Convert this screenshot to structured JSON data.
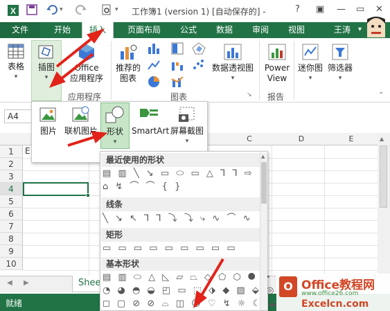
{
  "titlebar": {
    "title": "工作簿1 (version 1) [自动保存的] -",
    "help": "?",
    "minimize": "—",
    "restore": "▭",
    "close": "✕",
    "save_icon": "save-icon",
    "undo_icon": "undo-icon",
    "redo_icon": "redo-icon"
  },
  "tabs": [
    "文件",
    "开始",
    "插入",
    "页面布局",
    "公式",
    "数据",
    "审阅",
    "视图"
  ],
  "active_tab": "插入",
  "user": "王涛",
  "ribbon": {
    "table": "表格",
    "illustrations": "插图",
    "office_apps_1": "Office",
    "office_apps_2": "应用程序",
    "recommended_charts_1": "推荐的",
    "recommended_charts_2": "图表",
    "pivot_chart": "数据透视图",
    "power_view_1": "Power",
    "power_view_2": "View",
    "sparkline": "迷你图",
    "filter": "筛选器",
    "group_apps": "应用程序",
    "group_charts": "图表",
    "group_reports": "报告"
  },
  "namebox": "A4",
  "columns": [
    "C",
    "D",
    "E"
  ],
  "rows": [
    "1",
    "2",
    "3",
    "4",
    "5",
    "6",
    "7",
    "8",
    "9",
    "10"
  ],
  "cell_E1": "E",
  "illustrations_menu": {
    "picture": "图片",
    "online_picture": "联机图片",
    "shapes": "形状",
    "smartart": "SmartArt",
    "screenshot": "屏幕截图"
  },
  "shapes_menu": {
    "recent": "最近使用的形状",
    "lines": "线条",
    "rectangles": "矩形",
    "basic": "基本形状",
    "recent_row1": "▤ ▥ ╲ ↘ ▭ ⬭ ▭ △ ⅂ ⅂ ⇨ ⇩",
    "recent_row2": "⌂ ↯ ⌒ ⌒ { }",
    "lines_row": "╲ ↘ ↖ ⅂ ⅂ ⤵ ⤵ ⤷ ∿ ⌒ ∿",
    "rect_row": "▭ ▭ ▭ ▭ ▭ ▭ ▭ ▭ ▭",
    "basic_row1": "▤ ▥ ⬭ △ ◺ ▱ ⏢ ◇ ⬠ ⬡ ⯃ ✚",
    "basic_row2": "◔ ◕ ◓ ◒ ◰ ▭ ⬚ ⬗ ◆ ▨ ⬙ ◎",
    "basic_row3": "◻ ▢ ⊘ ⊘ ⌓ ◫ ☺ ♡ ↯ ☼ ☾ ☁"
  },
  "sheet_tab": "Shee",
  "status": "就绪",
  "watermark": {
    "logo": "O",
    "line1": "Office教程网",
    "line2": "www.office26.com",
    "line3": "Excelcn.com"
  },
  "colors": {
    "accent": "#217346",
    "arrow": "#e2231a",
    "watermark": "#d24726"
  }
}
